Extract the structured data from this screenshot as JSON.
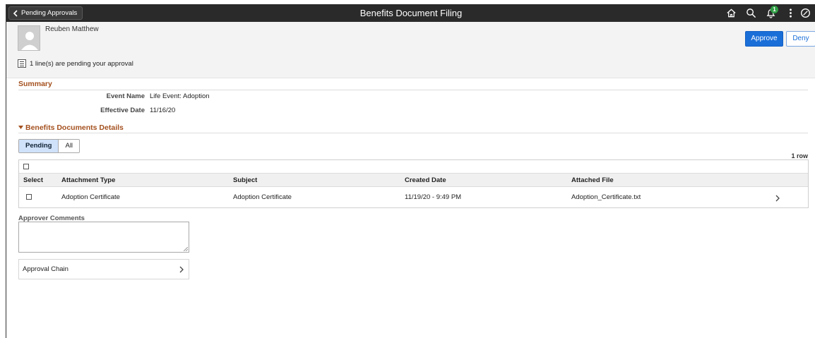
{
  "header": {
    "back_label": "Pending Approvals",
    "title": "Benefits Document Filing",
    "icons": [
      "home-icon",
      "search-icon",
      "notification-icon",
      "actions-menu-icon",
      "navbar-icon"
    ],
    "notification_count": "1"
  },
  "employee": {
    "name": "Reuben Matthew"
  },
  "actions": {
    "approve_label": "Approve",
    "deny_label": "Deny"
  },
  "pending_message": "1 line(s) are pending your approval",
  "summary": {
    "title": "Summary",
    "event_name_label": "Event Name",
    "event_name_value": "Life Event: Adoption",
    "effective_date_label": "Effective Date",
    "effective_date_value": "11/16/20"
  },
  "details": {
    "title": "Benefits Documents Details",
    "tabs": [
      "Pending",
      "All"
    ],
    "active_tab": "Pending",
    "row_count": "1 row",
    "columns": [
      "Select",
      "Attachment Type",
      "Subject",
      "Created Date",
      "Attached File"
    ],
    "rows": [
      {
        "attachment_type": "Adoption Certificate",
        "subject": "Adoption Certificate",
        "created_date": "11/19/20 - 9:49 PM",
        "attached_file": "Adoption_Certificate.txt"
      }
    ]
  },
  "comments": {
    "label": "Approver Comments",
    "value": ""
  },
  "approval_chain": {
    "label": "Approval Chain"
  },
  "colors": {
    "header_bg": "#2a2a2a",
    "accent_blue": "#1a6ed8",
    "section_title": "#a4511f",
    "badge_green": "#2f9e44"
  }
}
